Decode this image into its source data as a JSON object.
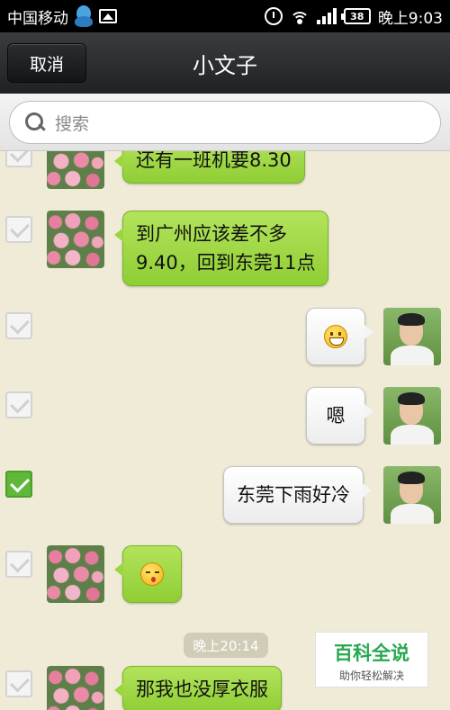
{
  "status_bar": {
    "carrier": "中国移动",
    "battery": "38",
    "time": "晚上9:03"
  },
  "header": {
    "cancel_label": "取消",
    "title": "小文子"
  },
  "search": {
    "placeholder": "搜索"
  },
  "messages": [
    {
      "side": "left",
      "text": "还有一班机要8.30",
      "checked": false
    },
    {
      "side": "left",
      "line1": "到广州应该差不多",
      "line2": "9.40，回到东莞11点",
      "checked": false
    },
    {
      "side": "right",
      "emoji": "grin-icon",
      "checked": false
    },
    {
      "side": "right",
      "text": "嗯",
      "checked": false
    },
    {
      "side": "right",
      "text": "东莞下雨好冷",
      "checked": true
    },
    {
      "side": "left",
      "emoji": "kiss-icon",
      "checked": false
    },
    {
      "side": "left",
      "text": "那我也没厚衣服",
      "checked": false
    }
  ],
  "timestamp": "晚上20:14",
  "watermark": {
    "title": "百科全说",
    "subtitle": "助你轻松解决"
  },
  "colors": {
    "chat_background": "#efebd6",
    "incoming_bubble": "#9bd63f",
    "outgoing_bubble": "#f4f4f4",
    "checked_accent": "#5fb83a"
  }
}
